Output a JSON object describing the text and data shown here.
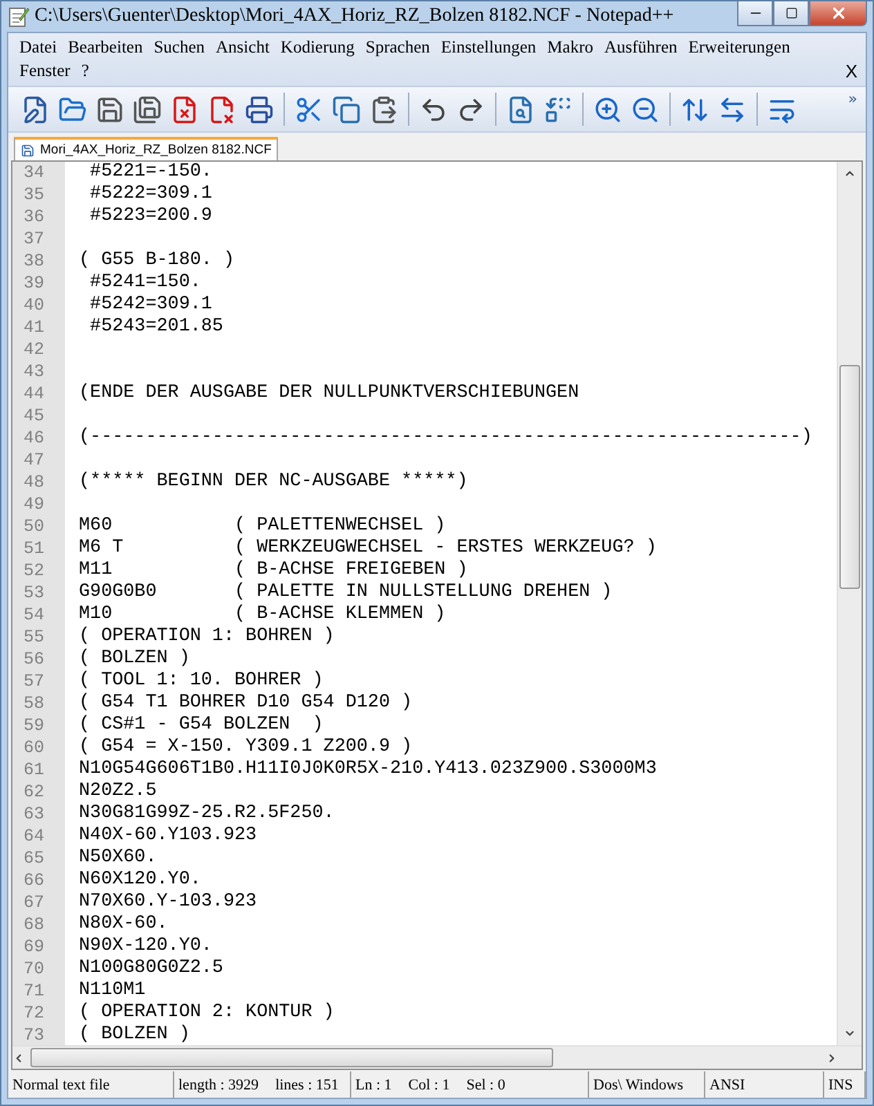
{
  "window": {
    "title": "C:\\Users\\Guenter\\Desktop\\Mori_4AX_Horiz_RZ_Bolzen 8182.NCF - Notepad++"
  },
  "menu": {
    "rows": [
      [
        "Datei",
        "Bearbeiten",
        "Suchen",
        "Ansicht",
        "Kodierung",
        "Sprachen",
        "Einstellungen",
        "Makro",
        "Ausführen",
        "Erweiterungen"
      ],
      [
        "Fenster",
        "?"
      ]
    ],
    "close_label": "X"
  },
  "toolbar": {
    "overflow": "»"
  },
  "tabs": [
    {
      "label": "Mori_4AX_Horiz_RZ_Bolzen 8182.NCF",
      "selected": true
    }
  ],
  "editor": {
    "lines": [
      {
        "number": "34",
        "text": " #5221=-150."
      },
      {
        "number": "35",
        "text": " #5222=309.1"
      },
      {
        "number": "36",
        "text": " #5223=200.9"
      },
      {
        "number": "37"
      },
      {
        "number": "38",
        "text": "( G55 B-180. )"
      },
      {
        "number": "39",
        "text": " #5241=150."
      },
      {
        "number": "40",
        "text": " #5242=309.1"
      },
      {
        "number": "41",
        "text": " #5243=201.85"
      },
      {
        "number": "42"
      },
      {
        "number": "43"
      },
      {
        "number": "44",
        "text": "(ENDE DER AUSGABE DER NULLPUNKTVERSCHIEBUNGEN"
      },
      {
        "number": "45"
      },
      {
        "number": "46",
        "text": "(----------------------------------------------------------------)"
      },
      {
        "number": "47"
      },
      {
        "number": "48",
        "text": "(***** BEGINN DER NC-AUSGABE *****)"
      },
      {
        "number": "49"
      },
      {
        "number": "50",
        "text": "M60           ( PALETTENWECHSEL )"
      },
      {
        "number": "51",
        "text": "M6 T          ( WERKZEUGWECHSEL - ERSTES WERKZEUG? )"
      },
      {
        "number": "52",
        "text": "M11           ( B-ACHSE FREIGEBEN )"
      },
      {
        "number": "53",
        "text": "G90G0B0       ( PALETTE IN NULLSTELLUNG DREHEN )"
      },
      {
        "number": "54",
        "text": "M10           ( B-ACHSE KLEMMEN )"
      },
      {
        "number": "55",
        "text": "( OPERATION 1: BOHREN )"
      },
      {
        "number": "56",
        "text": "( BOLZEN )"
      },
      {
        "number": "57",
        "text": "( TOOL 1: 10. BOHRER )"
      },
      {
        "number": "58",
        "text": "( G54 T1 BOHRER D10 G54 D120 )"
      },
      {
        "number": "59",
        "text": "( CS#1 - G54 BOLZEN  )"
      },
      {
        "number": "60",
        "text": "( G54 = X-150. Y309.1 Z200.9 )"
      },
      {
        "number": "61",
        "text": "N10G54G606T1B0.H11I0J0K0R5X-210.Y413.023Z900.S3000M3"
      },
      {
        "number": "62",
        "text": "N20Z2.5"
      },
      {
        "number": "63",
        "text": "N30G81G99Z-25.R2.5F250."
      },
      {
        "number": "64",
        "text": "N40X-60.Y103.923"
      },
      {
        "number": "65",
        "text": "N50X60."
      },
      {
        "number": "66",
        "text": "N60X120.Y0."
      },
      {
        "number": "67",
        "text": "N70X60.Y-103.923"
      },
      {
        "number": "68",
        "text": "N80X-60."
      },
      {
        "number": "69",
        "text": "N90X-120.Y0."
      },
      {
        "number": "70",
        "text": "N100G80G0Z2.5"
      },
      {
        "number": "71",
        "text": "N110M1"
      },
      {
        "number": "72",
        "text": "( OPERATION 2: KONTUR )"
      },
      {
        "number": "73",
        "text": "( BOLZEN )"
      }
    ]
  },
  "status_bar": [
    [
      "Normal text file"
    ],
    [
      "length : 3929",
      "lines : 151"
    ],
    [
      "Ln : 1",
      "Col : 1",
      "Sel : 0"
    ],
    [
      "Dos\\ Windows"
    ],
    [
      "ANSI"
    ],
    [
      "INS"
    ]
  ]
}
